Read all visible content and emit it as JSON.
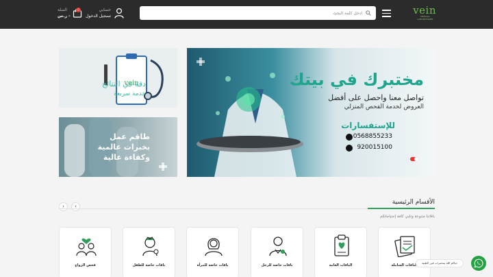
{
  "header": {
    "logo": "vein",
    "logo_tagline": "MEDICAL LABORATORIES",
    "search_placeholder": "ادخل كلمة البحث",
    "account_label": "حسابي",
    "account_action": "تسجيل الدخول",
    "cart_label": "السلة",
    "cart_count": "0",
    "cart_price": "- ر.س"
  },
  "banner_main": {
    "title": "مختبرك في بيتك",
    "line1": "تواصل معنا واحصل على أفضل",
    "line2": "العروض لخدمة الفحص المنزلي",
    "inquiries_label": "للإستفسارات",
    "phone_1": "0568855233",
    "phone_2": "920015100"
  },
  "banner_side1": {
    "line1": "دقة في النتائج",
    "line2": "خدمة سريعة"
  },
  "banner_side2": {
    "line1": "طاقم عمل",
    "line2": "بخبرات عالمية",
    "line3": "وكفاءة عالية"
  },
  "section": {
    "title": "الأقسام الرئيسية",
    "subtitle": "باقاتنا متنوعة وتلبي كافة إحتياجاتكم",
    "prev_arrow": "‹",
    "next_arrow": "›"
  },
  "categories": [
    {
      "label": "الباقات الشاملة",
      "icon": "documents-icon"
    },
    {
      "label": "الباقات العامة",
      "icon": "clipboard-heart-icon"
    },
    {
      "label": "باقات خاصة للرجل",
      "icon": "man-doctor-icon"
    },
    {
      "label": "باقات خاصة للمرأة",
      "icon": "woman-icon"
    },
    {
      "label": "باقات خاصة للطفل",
      "icon": "child-icon"
    },
    {
      "label": "فحص الزواج",
      "icon": "couple-icon"
    }
  ],
  "whatsapp": {
    "tooltip": "حياكم الله بمختبرات فين الطبية"
  },
  "colors": {
    "header_bg": "#2b2b2b",
    "brand_green": "#2e9e5a",
    "banner_teal": "#1fa48d",
    "whatsapp": "#25a244"
  }
}
